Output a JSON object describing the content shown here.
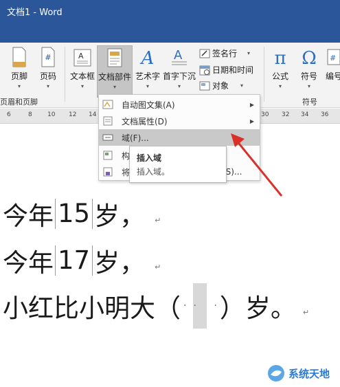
{
  "window": {
    "title": "文档1 - Word"
  },
  "ribbon": {
    "header_footer_group": {
      "label": "页眉和页脚",
      "footer": "页脚",
      "page_number": "页码"
    },
    "text_group": {
      "textbox": "文本框",
      "quick_parts": "文档部件",
      "wordart": "艺术字",
      "dropcap": "首字下沉",
      "signature_line": "签名行",
      "date_time": "日期和时间",
      "object": "对象"
    },
    "symbols_group": {
      "label": "符号",
      "equation": "公式",
      "symbol": "符号",
      "numbering": "编号"
    }
  },
  "ruler": {
    "ticks": [
      "6",
      "8",
      "10",
      "12",
      "14",
      "30",
      "32",
      "34",
      "36"
    ]
  },
  "menu": {
    "items": [
      {
        "label": "自动图文集(A)",
        "submenu": true
      },
      {
        "label": "文档属性(D)",
        "submenu": true
      },
      {
        "label": "域(F)...",
        "submenu": false
      },
      {
        "label": "构",
        "submenu": false
      },
      {
        "label": "将",
        "trailing": "(S)...",
        "submenu": false
      }
    ]
  },
  "tooltip": {
    "title": "插入域",
    "description": "插入域。"
  },
  "document": {
    "line1": {
      "before": "今年",
      "field": "15",
      "after": "岁，"
    },
    "line2": {
      "before": "今年",
      "field": "17",
      "after": "岁，"
    },
    "line3": {
      "before": "小红比小明大（",
      "after": "）岁。"
    },
    "paragraph_mark": "↵"
  },
  "watermark": {
    "text": "系统天地"
  },
  "colors": {
    "title_bar": "#2b579a",
    "arrow": "#d9312a",
    "watermark": "#2a7bd8"
  }
}
